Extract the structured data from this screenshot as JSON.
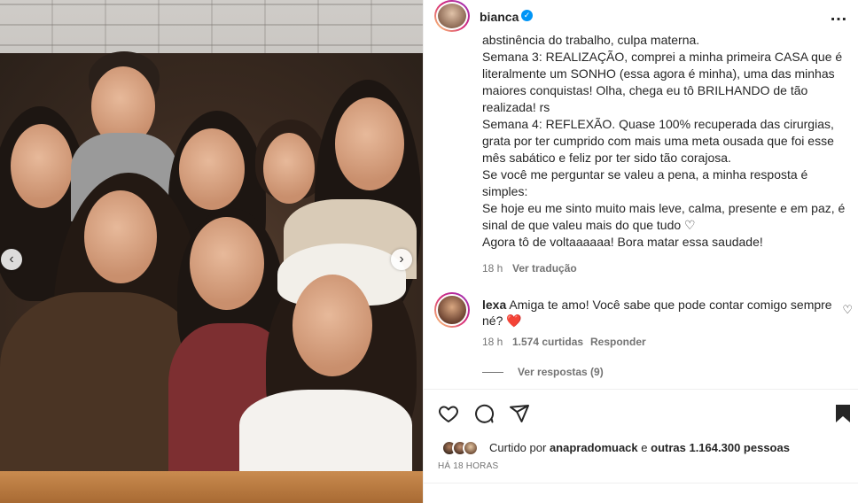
{
  "post": {
    "username": "bianca",
    "verified_mark": "✓",
    "more_icon": "…",
    "caption_lines": [
      "abstinência do trabalho, culpa materna.",
      "Semana 3: REALIZAÇÃO, comprei a minha primeira CASA que é literalmente um SONHO (essa agora é minha), uma das minhas maiores conquistas! Olha, chega eu tô BRILHANDO de tão realizada! rs",
      "Semana 4: REFLEXÃO. Quase 100% recuperada das cirurgias, grata por ter cumprido com mais uma meta ousada que foi esse mês sabático e feliz por ter sido tão corajosa.",
      "Se você me perguntar se valeu a pena, a minha resposta é simples:",
      "Se hoje eu me sinto muito mais leve, calma, presente e em paz, é sinal de que valeu mais do que tudo ♡",
      "Agora tô de voltaaaaaa! Bora matar essa saudade!"
    ],
    "caption_time": "18 h",
    "see_translation": "Ver tradução"
  },
  "comment": {
    "username": "lexa",
    "text": "Amiga te amo! Você sabe que pode contar comigo sempre né? ❤️",
    "time": "18 h",
    "likes": "1.574 curtidas",
    "reply": "Responder",
    "view_replies": "Ver respostas (9)"
  },
  "footer": {
    "liked_by_prefix": "Curtido por",
    "liked_by_user": "anapradomuack",
    "liked_by_and": "e",
    "liked_by_others": "outras 1.164.300 pessoas",
    "time_ago": "HÁ 18 HORAS"
  },
  "colors": {
    "accent_blue": "#0095f6",
    "heart_red": "#e0245e",
    "text_primary": "#262626",
    "text_secondary": "#737373"
  },
  "icons": {
    "prev": "carousel-prev-icon",
    "next": "carousel-next-icon",
    "like": "heart-icon",
    "comment": "comment-icon",
    "share": "share-icon",
    "save": "bookmark-icon"
  }
}
